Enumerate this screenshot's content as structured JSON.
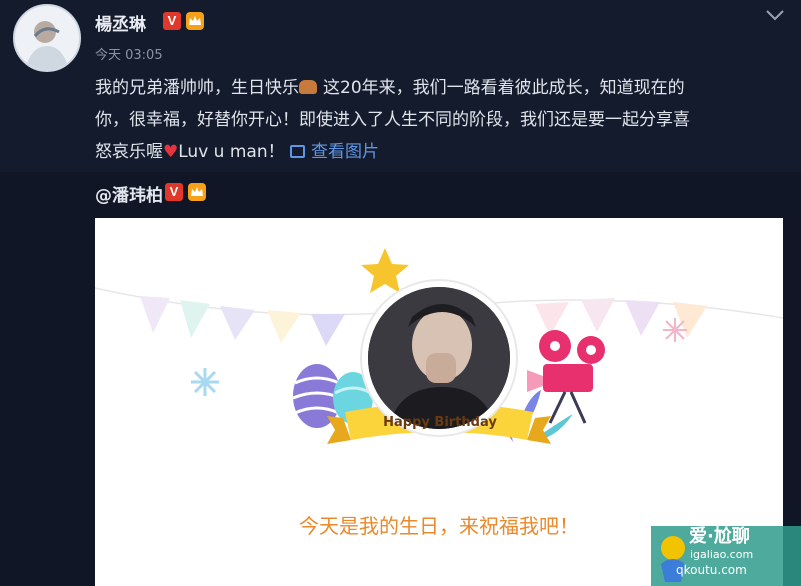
{
  "post": {
    "username": "楊丞琳",
    "verified_badge": "V",
    "level_badge": "lv-crown-icon",
    "timestamp": "今天 03:05",
    "text_line1": "我的兄弟潘帅帅，生日快乐",
    "text_line1b": "这20年来，我们一路看着彼此成长，知道现在的",
    "text_line2": "你，很幸福，好替你开心！即使进入了人生不同的阶段，我们还是要一起分享喜",
    "text_line3a": "怒哀乐喔",
    "text_line3b": "Luv u man！",
    "view_image_label": "查看图片"
  },
  "repost": {
    "author": "@潘玮柏",
    "card_banner": "Happy Birthday",
    "card_message": "今天是我的生日，来祝福我吧！"
  },
  "watermark": {
    "line1": "爱·尬聊",
    "line2": "igaliao.com",
    "line3": "qkoutu.com"
  },
  "colors": {
    "background": "#101626",
    "link": "#5f97e6",
    "accent_orange": "#e9892b",
    "verified": "#e0392b",
    "level": "#f6a11a"
  }
}
